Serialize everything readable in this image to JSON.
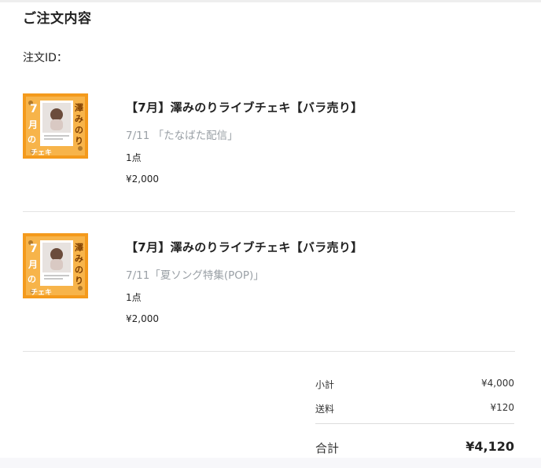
{
  "page": {
    "title": "ご注文内容",
    "order_id_label": "注文ID："
  },
  "items": [
    {
      "title": "【7月】澤みのりライブチェキ【バラ売り】",
      "variant": "7/11 「たなばた配信」",
      "quantity": "1点",
      "price": "¥2,000",
      "thumbnail": {
        "side_text": "澤みのり",
        "bottom_text": "7月のチェキ",
        "accent": "#f49a1c"
      }
    },
    {
      "title": "【7月】澤みのりライブチェキ【バラ売り】",
      "variant": "7/11「夏ソング特集(POP)」",
      "quantity": "1点",
      "price": "¥2,000",
      "thumbnail": {
        "side_text": "澤みのり",
        "bottom_text": "7月のチェキ",
        "accent": "#f49a1c"
      }
    }
  ],
  "summary": {
    "subtotal_label": "小計",
    "subtotal_value": "¥4,000",
    "shipping_label": "送料",
    "shipping_value": "¥120",
    "total_label": "合計",
    "total_value": "¥4,120"
  }
}
